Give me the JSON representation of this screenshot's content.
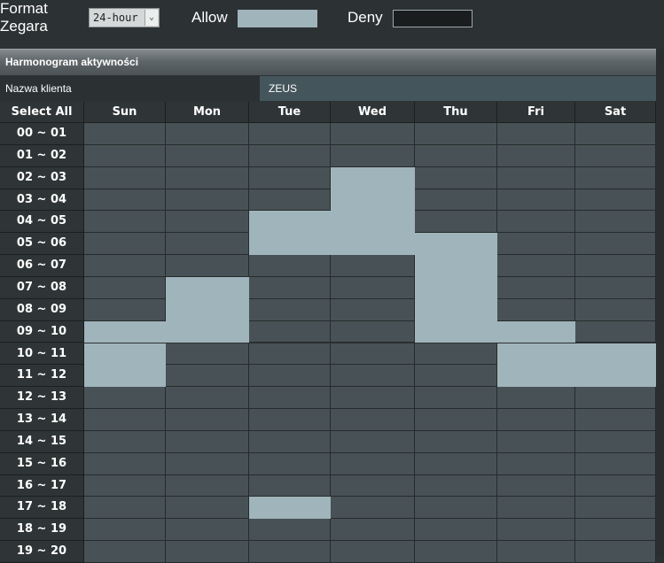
{
  "clock_format": {
    "label_line1": "Format",
    "label_line2": "Zegara",
    "selected": "24-hour"
  },
  "legend": {
    "allow_label": "Allow",
    "deny_label": "Deny",
    "allow_color": "#a0b4bb",
    "deny_color": "#1a1d1e"
  },
  "schedule": {
    "title": "Harmonogram aktywności",
    "client_label": "Nazwa klienta",
    "client_value": "ZEUS",
    "select_all": "Select All",
    "days": [
      "Sun",
      "Mon",
      "Tue",
      "Wed",
      "Thu",
      "Fri",
      "Sat"
    ],
    "hours": [
      "00 ~ 01",
      "01 ~ 02",
      "02 ~ 03",
      "03 ~ 04",
      "04 ~ 05",
      "05 ~ 06",
      "06 ~ 07",
      "07 ~ 08",
      "08 ~ 09",
      "09 ~ 10",
      "10 ~ 11",
      "11 ~ 12",
      "12 ~ 13",
      "13 ~ 14",
      "14 ~ 15",
      "15 ~ 16",
      "16 ~ 17",
      "17 ~ 18",
      "18 ~ 19",
      "19 ~ 20"
    ],
    "allowed": [
      [
        0,
        0,
        0,
        0,
        0,
        0,
        0
      ],
      [
        0,
        0,
        0,
        0,
        0,
        0,
        0
      ],
      [
        0,
        0,
        0,
        1,
        0,
        0,
        0
      ],
      [
        0,
        0,
        0,
        1,
        0,
        0,
        0
      ],
      [
        0,
        0,
        1,
        1,
        0,
        0,
        0
      ],
      [
        0,
        0,
        1,
        1,
        1,
        0,
        0
      ],
      [
        0,
        0,
        0,
        0,
        1,
        0,
        0
      ],
      [
        0,
        1,
        0,
        0,
        1,
        0,
        0
      ],
      [
        0,
        1,
        0,
        0,
        1,
        0,
        0
      ],
      [
        1,
        1,
        0,
        0,
        1,
        1,
        0
      ],
      [
        1,
        0,
        0,
        0,
        0,
        1,
        1
      ],
      [
        1,
        0,
        0,
        0,
        0,
        1,
        1
      ],
      [
        0,
        0,
        0,
        0,
        0,
        0,
        0
      ],
      [
        0,
        0,
        0,
        0,
        0,
        0,
        0
      ],
      [
        0,
        0,
        0,
        0,
        0,
        0,
        0
      ],
      [
        0,
        0,
        0,
        0,
        0,
        0,
        0
      ],
      [
        0,
        0,
        0,
        0,
        0,
        0,
        0
      ],
      [
        0,
        0,
        1,
        0,
        0,
        0,
        0
      ],
      [
        0,
        0,
        0,
        0,
        0,
        0,
        0
      ],
      [
        0,
        0,
        0,
        0,
        0,
        0,
        0
      ]
    ]
  }
}
